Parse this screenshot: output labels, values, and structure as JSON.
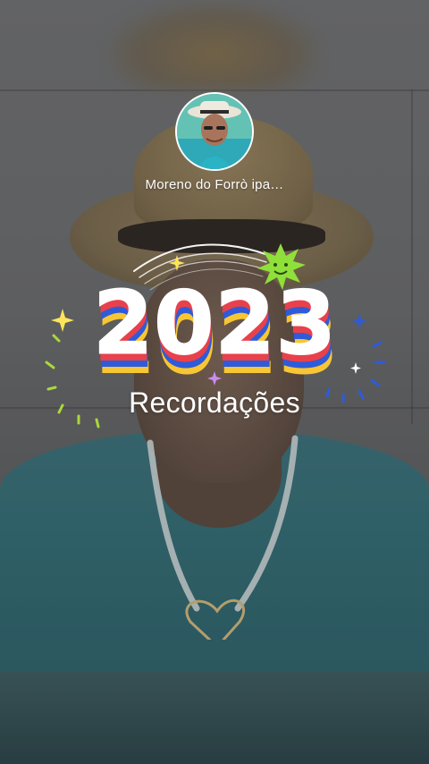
{
  "profile": {
    "name": "Moreno do Forrò ipa…",
    "avatar_icon": "profile-photo"
  },
  "recap": {
    "year": "2023",
    "subtitle": "Recordações"
  },
  "colors": {
    "stripe_red": "#e8414b",
    "stripe_blue": "#2f5bd8",
    "stripe_yellow": "#f7c634",
    "sun_green": "#8fe03a",
    "text": "#ffffff"
  }
}
